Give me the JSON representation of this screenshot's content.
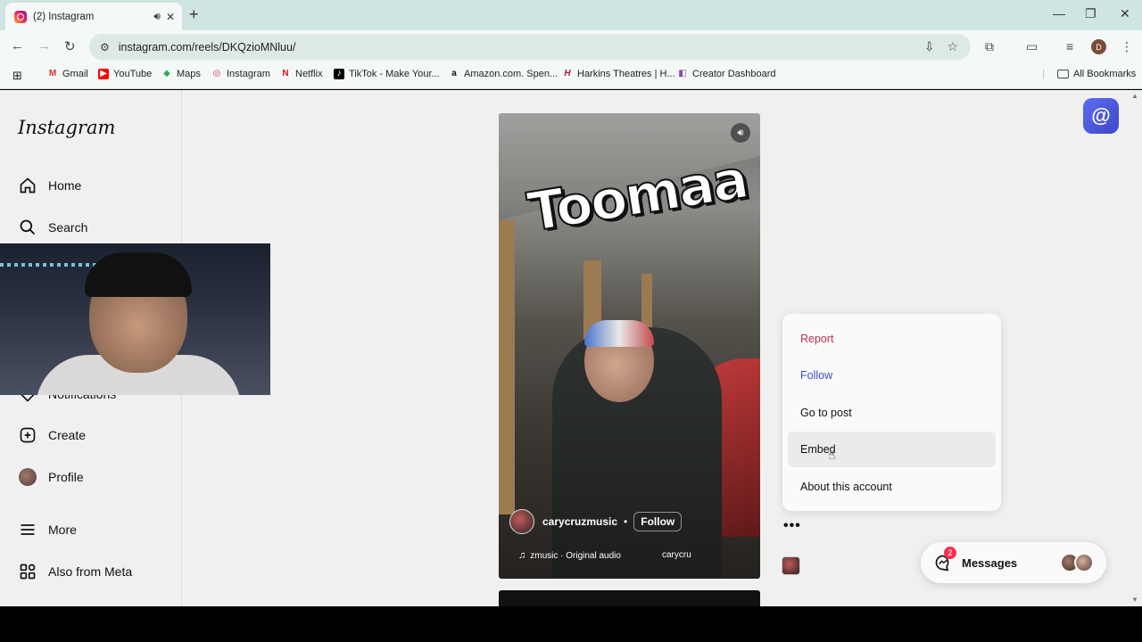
{
  "browser": {
    "tab_title": "(2) Instagram",
    "tab_sound_icon": "speaker-icon",
    "new_tab_label": "+",
    "url": "instagram.com/reels/DKQzioMNluu/",
    "profile_initial": "D",
    "bookmarks": [
      {
        "label": "Gmail",
        "icon": "M",
        "color": "#d93025"
      },
      {
        "label": "YouTube",
        "icon": "▶",
        "color": "#ff0000"
      },
      {
        "label": "Maps",
        "icon": "◆",
        "color": "#34a853"
      },
      {
        "label": "Instagram",
        "icon": "◎",
        "color": "#e1306c"
      },
      {
        "label": "Netflix",
        "icon": "N",
        "color": "#e50914"
      },
      {
        "label": "TikTok - Make Your...",
        "icon": "♪",
        "color": "#000000"
      },
      {
        "label": "Amazon.com. Spen...",
        "icon": "a",
        "color": "#111111"
      },
      {
        "label": "Harkins Theatres | H...",
        "icon": "H",
        "color": "#a31d36"
      },
      {
        "label": "Creator Dashboard",
        "icon": "◧",
        "color": "#8e44ad"
      }
    ],
    "all_bookmarks": "All Bookmarks"
  },
  "sidebar": {
    "logo": "Instagram",
    "items": [
      {
        "label": "Home",
        "icon": "home-icon"
      },
      {
        "label": "Search",
        "icon": "search-icon"
      },
      {
        "label": "Notifications",
        "icon": "heart-icon"
      },
      {
        "label": "Create",
        "icon": "plus-square-icon"
      },
      {
        "label": "Profile",
        "icon": "avatar"
      },
      {
        "label": "More",
        "icon": "menu-icon"
      },
      {
        "label": "Also from Meta",
        "icon": "meta-grid-icon"
      }
    ]
  },
  "reel": {
    "overlay_text": "Toomaa",
    "username": "carycruzmusic",
    "separator": "•",
    "follow_label": "Follow",
    "audio_label": "zmusic · Original audio",
    "audio_tag": "carycru"
  },
  "menu": {
    "items": [
      {
        "label": "Report",
        "color": "#c0304f"
      },
      {
        "label": "Follow",
        "color": "#3a4bd0"
      },
      {
        "label": "Go to post",
        "color": "#111111"
      },
      {
        "label": "Embed",
        "color": "#111111"
      },
      {
        "label": "About this account",
        "color": "#111111"
      }
    ],
    "hover_index": 3
  },
  "more_button": "•••",
  "messages": {
    "label": "Messages",
    "badge": "2"
  },
  "assistant_icon": "@"
}
